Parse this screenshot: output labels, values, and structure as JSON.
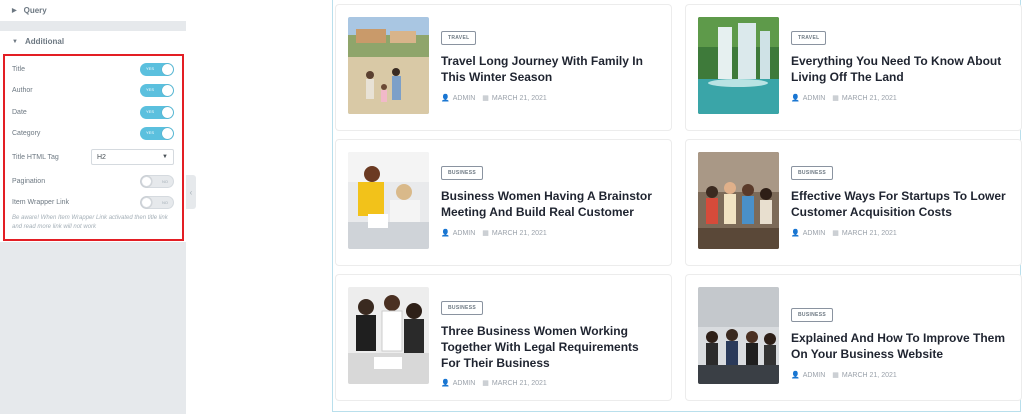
{
  "panel": {
    "query_label": "Query",
    "additional_label": "Additional",
    "controls": [
      {
        "label": "Title",
        "toggle": "YES",
        "state": "on"
      },
      {
        "label": "Author",
        "toggle": "YES",
        "state": "on"
      },
      {
        "label": "Date",
        "toggle": "YES",
        "state": "on"
      },
      {
        "label": "Category",
        "toggle": "YES",
        "state": "on"
      }
    ],
    "title_html_tag": {
      "label": "Title HTML Tag",
      "value": "H2"
    },
    "pagination": {
      "label": "Pagination",
      "toggle": "NO",
      "state": "off"
    },
    "item_wrapper_link": {
      "label": "Item Wrapper Link",
      "toggle": "NO",
      "state": "off"
    },
    "note": "Be aware! When Item Wrapper Link activated then title link and read more link will not work"
  },
  "posts": [
    {
      "category": "TRAVEL",
      "title": "Travel Long Journey With Family In This Winter Season",
      "author": "ADMIN",
      "date": "MARCH 21, 2021",
      "image": "family-beach-photo"
    },
    {
      "category": "TRAVEL",
      "title": "Everything You Need To Know About Living Off The Land",
      "author": "ADMIN",
      "date": "MARCH 21, 2021",
      "image": "waterfall-photo"
    },
    {
      "category": "BUSINESS",
      "title": "Business Women Having A Brainstor Meeting And Build Real Customer",
      "author": "ADMIN",
      "date": "MARCH 21, 2021",
      "image": "women-meeting-photo"
    },
    {
      "category": "BUSINESS",
      "title": "Effective Ways For Startups To Lower Customer Acquisition Costs",
      "author": "ADMIN",
      "date": "MARCH 21, 2021",
      "image": "startup-team-photo"
    },
    {
      "category": "BUSINESS",
      "title": "Three Business Women Working Together With Legal Requirements For Their Business",
      "author": "ADMIN",
      "date": "MARCH 21, 2021",
      "image": "three-women-photo"
    },
    {
      "category": "BUSINESS",
      "title": "Explained And How To Improve Them On Your Business Website",
      "author": "ADMIN",
      "date": "MARCH 21, 2021",
      "image": "office-team-photo"
    }
  ],
  "colors": {
    "highlight": "#e31e24",
    "toggle_on": "#5bc0de",
    "preview_border": "#b9dfec"
  }
}
